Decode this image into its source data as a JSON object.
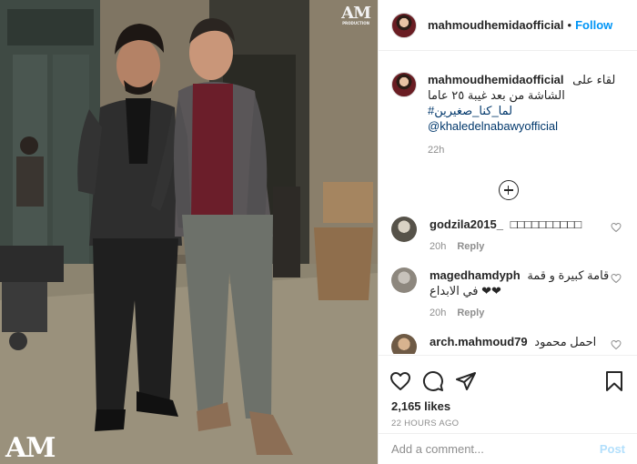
{
  "post": {
    "username": "mahmoudhemidaofficial",
    "separator": "•",
    "follow_label": "Follow",
    "watermark": "AM"
  },
  "caption": {
    "username": "mahmoudhemidaofficial",
    "line1": "لقاء على",
    "line2": "الشاشة من بعد غيبة ٢٥ عاما",
    "hashtag": "#لما_كنا_صغيرين",
    "mention": "@khaledelnabawyofficial",
    "time": "22h"
  },
  "comments": [
    {
      "username": "godzila2015_",
      "text": "□□□□□□□□□□",
      "time": "20h",
      "reply": "Reply"
    },
    {
      "username": "magedhamdyph",
      "text": "قامة كبيرة و قمة",
      "text2": "في الابداع ❤❤",
      "time": "20h",
      "reply": "Reply"
    },
    {
      "username": "arch.mahmoud79",
      "text": "احمل محمود"
    }
  ],
  "actions": {
    "likes": "2,165 likes",
    "time_ago": "22 HOURS AGO",
    "comment_placeholder": "Add a comment...",
    "post_label": "Post"
  },
  "icons": [
    "heart-icon",
    "comment-icon",
    "share-icon",
    "bookmark-icon",
    "plus-circle-icon"
  ]
}
